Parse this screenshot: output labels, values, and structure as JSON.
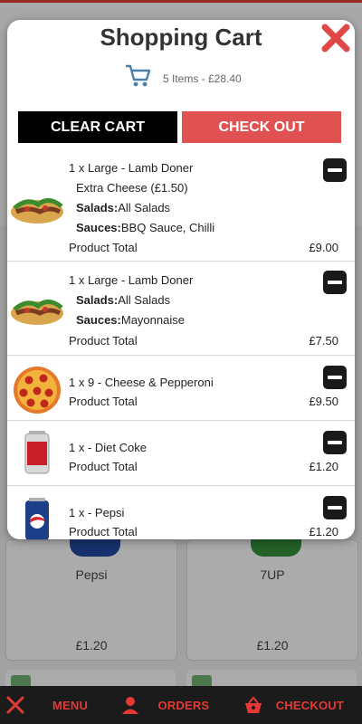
{
  "background": {
    "cards": [
      {
        "name": "Pepsi",
        "price": "£1.20"
      },
      {
        "name": "7UP",
        "price": "£1.20"
      }
    ]
  },
  "modal": {
    "title": "Shopping Cart",
    "summary": "5 Items - £28.40",
    "clear_label": "CLEAR CART",
    "checkout_label": "CHECK OUT",
    "total_label": "Product Total",
    "items": [
      {
        "title": "1 x Large - Lamb Doner",
        "extra": "Extra Cheese (£1.50)",
        "salads_key": "Salads:",
        "salads_val": "All Salads",
        "sauces_key": "Sauces:",
        "sauces_val": "BBQ Sauce, Chilli",
        "total": "£9.00",
        "image": "kebab-wrap"
      },
      {
        "title": "1 x Large - Lamb Doner",
        "salads_key": "Salads:",
        "salads_val": "All Salads",
        "sauces_key": "Sauces:",
        "sauces_val": "Mayonnaise",
        "total": "£7.50",
        "image": "kebab-wrap"
      },
      {
        "title": "1 x 9 - Cheese & Pepperoni",
        "total": "£9.50",
        "image": "pizza"
      },
      {
        "title": "1 x - Diet Coke",
        "total": "£1.20",
        "image": "diet-coke-can"
      },
      {
        "title": "1 x - Pepsi",
        "total": "£1.20",
        "image": "pepsi-can"
      }
    ]
  },
  "nav": {
    "menu_label": "MENU",
    "orders_label": "ORDERS",
    "checkout_label": "CHECKOUT"
  },
  "colors": {
    "accent_red": "#e53935",
    "checkout_button": "#e05252",
    "clear_button": "#000000",
    "nav_background": "#1b1b1b"
  }
}
